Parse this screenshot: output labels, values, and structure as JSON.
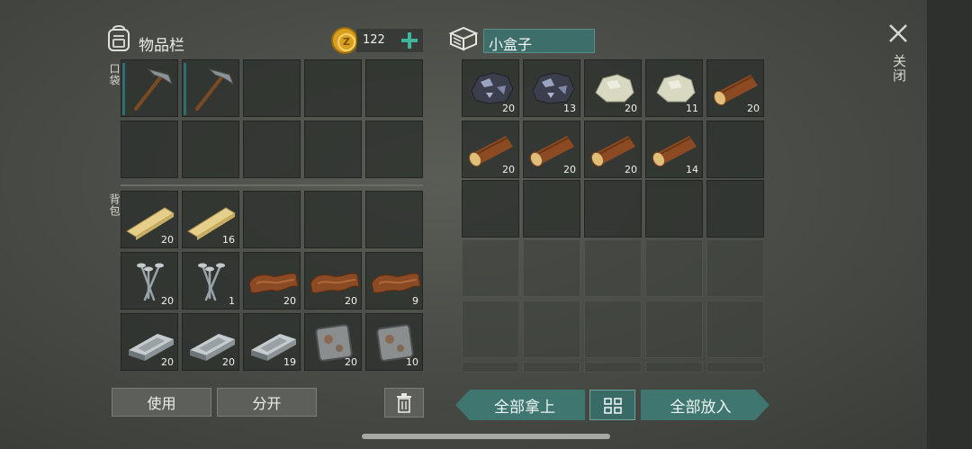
{
  "header": {
    "inventory_title": "物品栏",
    "coins": "122",
    "box_name": "小盒子",
    "close_label": "关闭"
  },
  "sections": {
    "pocket_label": "口袋",
    "backpack_label": "背包"
  },
  "buttons": {
    "use": "使用",
    "split": "分开",
    "take_all": "全部拿上",
    "put_all": "全部放入"
  },
  "pocket": [
    {
      "item": "pickaxe",
      "qty": ""
    },
    {
      "item": "pickaxe",
      "qty": ""
    }
  ],
  "backpack": [
    {
      "item": "plank",
      "qty": "20"
    },
    {
      "item": "plank",
      "qty": "16"
    },
    {
      "item": "nails",
      "qty": "20"
    },
    {
      "item": "nails",
      "qty": "1"
    },
    {
      "item": "leather",
      "qty": "20"
    },
    {
      "item": "leather",
      "qty": "20"
    },
    {
      "item": "leather",
      "qty": "9"
    },
    {
      "item": "iron-ingot",
      "qty": "20"
    },
    {
      "item": "iron-ingot",
      "qty": "20"
    },
    {
      "item": "iron-ingot",
      "qty": "19"
    },
    {
      "item": "metal-plate",
      "qty": "20"
    },
    {
      "item": "metal-plate",
      "qty": "10"
    }
  ],
  "box": [
    {
      "item": "iron-ore",
      "qty": "20"
    },
    {
      "item": "iron-ore",
      "qty": "13"
    },
    {
      "item": "stone",
      "qty": "20"
    },
    {
      "item": "stone",
      "qty": "11"
    },
    {
      "item": "log",
      "qty": "20"
    },
    {
      "item": "log",
      "qty": "20"
    },
    {
      "item": "log",
      "qty": "20"
    },
    {
      "item": "log",
      "qty": "20"
    },
    {
      "item": "log",
      "qty": "14"
    }
  ],
  "colors": {
    "accent_teal": "#3f7670",
    "plus_green": "#3fb59a",
    "coin_gold": "#d9a020"
  }
}
